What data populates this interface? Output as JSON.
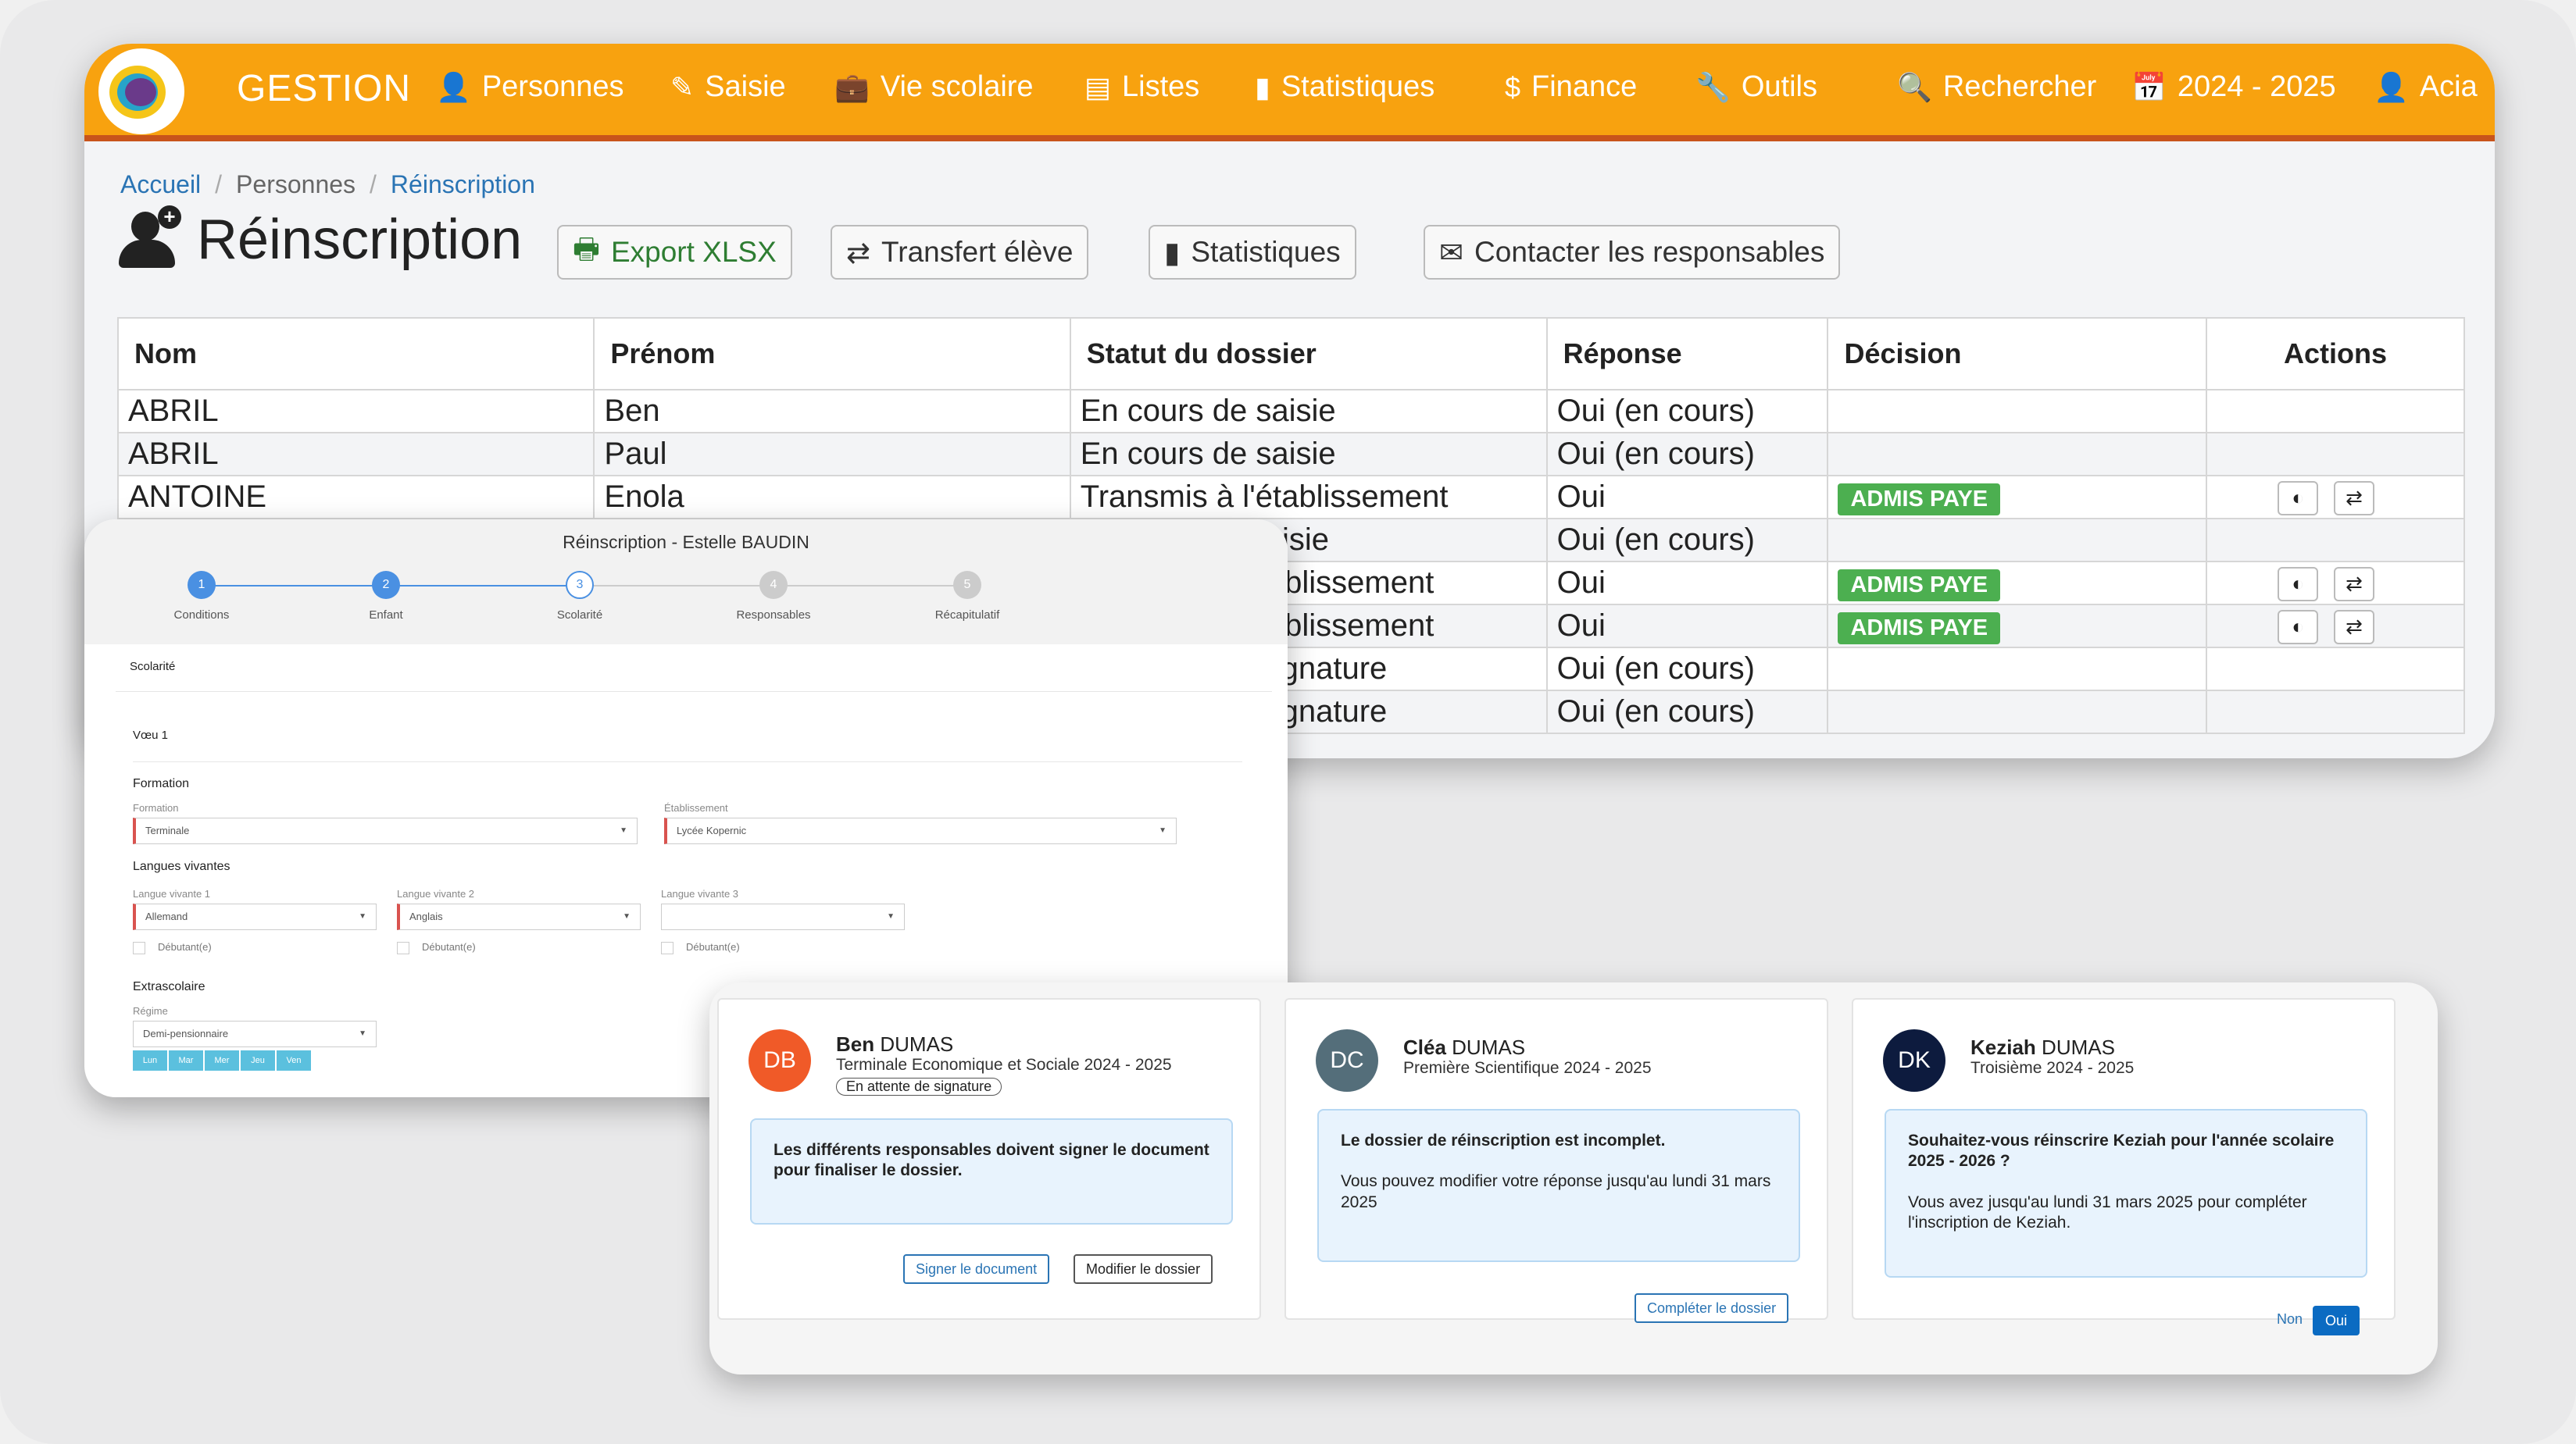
{
  "topbar": {
    "brand": "GESTION",
    "nav": [
      {
        "label": "Personnes",
        "icon": "user-icon"
      },
      {
        "label": "Saisie",
        "icon": "edit-icon"
      },
      {
        "label": "Vie scolaire",
        "icon": "briefcase-icon"
      },
      {
        "label": "Listes",
        "icon": "list-icon"
      },
      {
        "label": "Statistiques",
        "icon": "bar-chart-icon"
      },
      {
        "label": "Finance",
        "icon": "dollar-icon"
      },
      {
        "label": "Outils",
        "icon": "wrench-icon"
      },
      {
        "label": "Rechercher",
        "icon": "search-icon"
      },
      {
        "label": "2024 - 2025",
        "icon": "calendar-icon"
      },
      {
        "label": "Acia",
        "icon": "user-icon"
      }
    ]
  },
  "breadcrumb": [
    "Accueil",
    "Personnes",
    "Réinscription"
  ],
  "page": {
    "title": "Réinscription",
    "buttons": {
      "export": "Export XLSX",
      "transfer": "Transfert élève",
      "stats": "Statistiques",
      "contact": "Contacter les responsables"
    }
  },
  "table": {
    "headers": [
      "Nom",
      "Prénom",
      "Statut du dossier",
      "Réponse",
      "Décision",
      "Actions"
    ],
    "rows": [
      {
        "nom": "ABRIL",
        "prenom": "Ben",
        "statut": "En cours de saisie",
        "reponse": "Oui (en cours)",
        "decision": ""
      },
      {
        "nom": "ABRIL",
        "prenom": "Paul",
        "statut": "En cours de saisie",
        "reponse": "Oui (en cours)",
        "decision": ""
      },
      {
        "nom": "ANTOINE",
        "prenom": "Enola",
        "statut": "Transmis à l'établissement",
        "reponse": "Oui",
        "decision": "ADMIS PAYE"
      },
      {
        "nom": "",
        "prenom": "",
        "statut": "saisie",
        "reponse": "Oui (en cours)",
        "decision": ""
      },
      {
        "nom": "",
        "prenom": "",
        "statut": "tablissement",
        "reponse": "Oui",
        "decision": "ADMIS PAYE"
      },
      {
        "nom": "",
        "prenom": "",
        "statut": "tablissement",
        "reponse": "Oui",
        "decision": "ADMIS PAYE"
      },
      {
        "nom": "",
        "prenom": "",
        "statut": "signature",
        "reponse": "Oui (en cours)",
        "decision": ""
      },
      {
        "nom": "",
        "prenom": "",
        "statut": "signature",
        "reponse": "Oui (en cours)",
        "decision": ""
      }
    ]
  },
  "form": {
    "title": "Réinscription - Estelle BAUDIN",
    "steps": [
      {
        "num": "1",
        "label": "Conditions"
      },
      {
        "num": "2",
        "label": "Enfant"
      },
      {
        "num": "3",
        "label": "Scolarité"
      },
      {
        "num": "4",
        "label": "Responsables"
      },
      {
        "num": "5",
        "label": "Récapitulatif"
      }
    ],
    "section": "Scolarité",
    "voeu": "Vœu 1",
    "formation_heading": "Formation",
    "formation_label": "Formation",
    "formation_value": "Terminale",
    "etab_label": "Établissement",
    "etab_value": "Lycée Kopernic",
    "langues_heading": "Langues vivantes",
    "lv1_label": "Langue vivante 1",
    "lv1_value": "Allemand",
    "lv2_label": "Langue vivante 2",
    "lv2_value": "Anglais",
    "lv3_label": "Langue vivante 3",
    "lv3_value": "",
    "debutant": "Débutant(e)",
    "extra_heading": "Extrascolaire",
    "regime_label": "Régime",
    "regime_value": "Demi-pensionnaire",
    "days": [
      "Lun",
      "Mar",
      "Mer",
      "Jeu",
      "Ven"
    ]
  },
  "portal": {
    "cards": [
      {
        "initials": "DB",
        "avatar_color": "#f05a28",
        "first": "Ben",
        "last": "DUMAS",
        "class": "Terminale Economique et Sociale 2024 - 2025",
        "status": "En attente de signature",
        "msg_bold": "Les différents responsables doivent signer le document pour finaliser le dossier.",
        "msg_text": "",
        "btn1": "Signer le document",
        "btn2": "Modifier le dossier"
      },
      {
        "initials": "DC",
        "avatar_color": "#546e7a",
        "first": "Cléa",
        "last": "DUMAS",
        "class": "Première Scientifique 2024 - 2025",
        "msg_bold": "Le dossier de réinscription est incomplet.",
        "msg_text": "Vous pouvez modifier votre réponse jusqu'au lundi 31 mars 2025",
        "btn1": "Compléter le dossier"
      },
      {
        "initials": "DK",
        "avatar_color": "#0d1b3e",
        "first": "Keziah",
        "last": "DUMAS",
        "class": "Troisième 2024 - 2025",
        "msg_bold": "Souhaitez-vous réinscrire Keziah pour l'année scolaire 2025 - 2026 ?",
        "msg_text": "Vous avez jusqu'au lundi 31 mars 2025 pour compléter l'inscription de Keziah.",
        "btn_no": "Non",
        "btn_yes": "Oui"
      }
    ]
  },
  "colors": {
    "topbar": "#f8a20f",
    "topbar_border": "#c8541b",
    "badge": "#4caf50",
    "link": "#2a74b4",
    "primary": "#0b6bc2"
  }
}
